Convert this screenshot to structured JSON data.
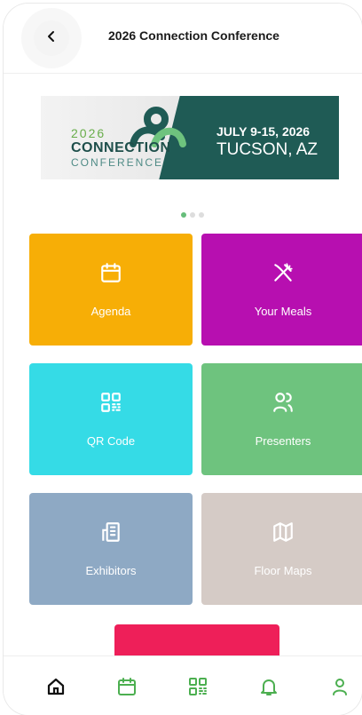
{
  "header": {
    "title": "2026 Connection Conference"
  },
  "banner": {
    "year": "2026",
    "brand_line1": "CONNECTION",
    "brand_line2": "CONFERENCE",
    "dates": "JULY 9-15, 2026",
    "location": "TUCSON, AZ"
  },
  "carousel": {
    "current": 1,
    "total": 3
  },
  "tiles": [
    {
      "label": "Agenda",
      "icon": "calendar-icon",
      "color": "#f7ae06"
    },
    {
      "label": "Your Meals",
      "icon": "utensils-icon",
      "color": "#b70fb0"
    },
    {
      "label": "QR Code",
      "icon": "qr-code-icon",
      "color": "#35dbe6"
    },
    {
      "label": "Presenters",
      "icon": "people-icon",
      "color": "#6ec37e"
    },
    {
      "label": "Exhibitors",
      "icon": "building-icon",
      "color": "#8ea9c4"
    },
    {
      "label": "Floor Maps",
      "icon": "map-icon",
      "color": "#d5cbc6"
    }
  ],
  "tabbar": {
    "items": [
      "home-icon",
      "calendar-icon",
      "qr-code-icon",
      "bell-icon",
      "person-icon"
    ],
    "accent": "#4caf50"
  },
  "colors": {
    "accent_pink": "#ee1f59"
  }
}
